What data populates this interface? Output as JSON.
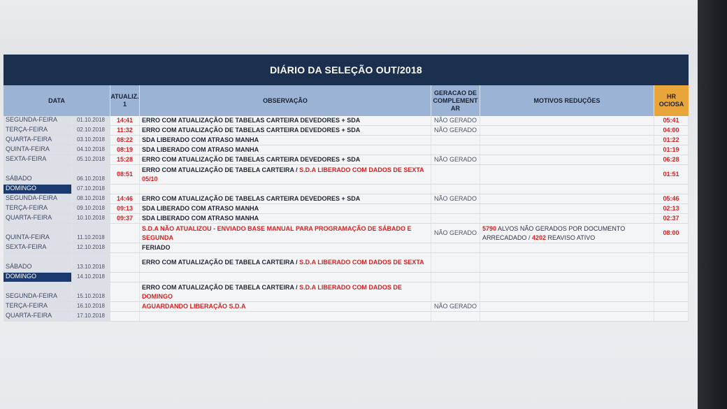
{
  "title": "DIÁRIO DA SELEÇÃO OUT/2018",
  "headers": {
    "data": "DATA",
    "atualiz": "ATUALIZ. 1",
    "observacao": "OBSERVAÇÃO",
    "geracao": "GERACAO DE COMPLEMENT AR",
    "motivos": "MOTIVOS REDUÇÕES",
    "hr_ociosa": "HR OCIOSA"
  },
  "colors": {
    "title_bg": "#1b2f4f",
    "header_bg": "#9bb3d4",
    "hr_header_bg": "#e8a53a",
    "alert_red": "#d61f1f",
    "weekend_highlight": "#1d3a6e"
  },
  "rows": [
    {
      "day": "SEGUNDA-FEIRA",
      "date": "01.10.2018",
      "time": "14:41",
      "obs": "ERRO COM ATUALIZAÇÃO DE TABELAS CARTEIRA DEVEDORES + SDA",
      "obs_red": "",
      "geracao": "NÃO GERADO",
      "motivo": "",
      "hr": "05:41"
    },
    {
      "day": "TERÇA-FEIRA",
      "date": "02.10.2018",
      "time": "11:32",
      "obs": "ERRO COM ATUALIZAÇÃO DE TABELAS CARTEIRA DEVEDORES + SDA",
      "obs_red": "",
      "geracao": "NÃO GERADO",
      "motivo": "",
      "hr": "04:00"
    },
    {
      "day": "QUARTA-FEIRA",
      "date": "03.10.2018",
      "time": "08:22",
      "obs": "SDA LIBERADO COM ATRASO MANHA",
      "obs_red": "",
      "geracao": "",
      "motivo": "",
      "hr": "01:22"
    },
    {
      "day": "QUINTA-FEIRA",
      "date": "04.10.2018",
      "time": "08:19",
      "obs": "SDA LIBERADO COM ATRASO MANHA",
      "obs_red": "",
      "geracao": "",
      "motivo": "",
      "hr": "01:19"
    },
    {
      "day": "SEXTA-FEIRA",
      "date": "05.10.2018",
      "time": "15:28",
      "obs": "ERRO COM ATUALIZAÇÃO DE TABELAS CARTEIRA DEVEDORES + SDA",
      "obs_red": "",
      "geracao": "NÃO GERADO",
      "motivo": "",
      "hr": "06:28"
    },
    {
      "day": "SÁBADO",
      "date": "06.10.2018",
      "time": "08:51",
      "obs": "ERRO COM ATUALIZAÇÃO DE TABELA CARTEIRA / ",
      "obs_red": "S.D.A  LIBERADO COM DADOS DE SEXTA 05/10",
      "geracao": "",
      "motivo": "",
      "hr": "01:51"
    },
    {
      "day": "DOMINGO",
      "date": "07.10.2018",
      "time": "",
      "obs": "",
      "obs_red": "",
      "geracao": "",
      "motivo": "",
      "hr": ""
    },
    {
      "day": "SEGUNDA-FEIRA",
      "date": "08.10.2018",
      "time": "14:46",
      "obs": "ERRO COM ATUALIZAÇÃO DE TABELAS CARTEIRA DEVEDORES + SDA",
      "obs_red": "",
      "geracao": "NÃO GERADO",
      "motivo": "",
      "hr": "05:46"
    },
    {
      "day": "TERÇA-FEIRA",
      "date": "09.10.2018",
      "time": "09:13",
      "obs": "SDA LIBERADO COM ATRASO MANHA",
      "obs_red": "",
      "geracao": "",
      "motivo": "",
      "hr": "02:13"
    },
    {
      "day": "QUARTA-FEIRA",
      "date": "10.10.2018",
      "time": "09:37",
      "obs": "SDA LIBERADO COM ATRASO MANHA",
      "obs_red": "",
      "geracao": "",
      "motivo": "",
      "hr": "02:37"
    },
    {
      "day": "QUINTA-FEIRA",
      "date": "11.10.2018",
      "time": "",
      "obs": "",
      "obs_red": "S.D.A NÃO ATUALIZOU - ENVIADO BASE MANUAL PARA PROGRAMAÇÃO DE SÁBADO E SEGUNDA",
      "geracao": "NÃO GERADO",
      "motivo_num1": "5790",
      "motivo_txt1": " ALVOS NÃO GERADOS POR DOCUMENTO ARRECADADO / ",
      "motivo_num2": "4202",
      "motivo_txt2": " REAVISO ATIVO",
      "hr": "08:00"
    },
    {
      "day": "SEXTA-FEIRA",
      "date": "12.10.2018",
      "time": "",
      "obs": "FERIADO",
      "obs_red": "",
      "geracao": "",
      "motivo": "",
      "hr": ""
    },
    {
      "day": "SÁBADO",
      "date": "13.10.2018",
      "time": "",
      "obs": "ERRO COM ATUALIZAÇÃO DE TABELA CARTEIRA / ",
      "obs_red": "S.D.A  LIBERADO COM DADOS DE SEXTA",
      "geracao": "",
      "motivo": "",
      "hr": ""
    },
    {
      "day": "DOMINGO",
      "date": "14.10.2018",
      "time": "",
      "obs": "",
      "obs_red": "",
      "geracao": "",
      "motivo": "",
      "hr": ""
    },
    {
      "day": "SEGUNDA-FEIRA",
      "date": "15.10.2018",
      "time": "",
      "obs": "ERRO COM ATUALIZAÇÃO DE TABELA CARTEIRA / ",
      "obs_red": "S.D.A  LIBERADO COM DADOS DE DOMINGO",
      "geracao": "",
      "motivo": "",
      "hr": ""
    },
    {
      "day": "TERÇA-FEIRA",
      "date": "16.10.2018",
      "time": "",
      "obs": "",
      "obs_red": "AGUARDANDO LIBERAÇÃO S.D.A",
      "geracao": "NÃO GERADO",
      "motivo": "",
      "hr": ""
    },
    {
      "day": "QUARTA-FEIRA",
      "date": "17.10.2018",
      "time": "",
      "obs": "",
      "obs_red": "",
      "geracao": "",
      "motivo": "",
      "hr": ""
    }
  ]
}
